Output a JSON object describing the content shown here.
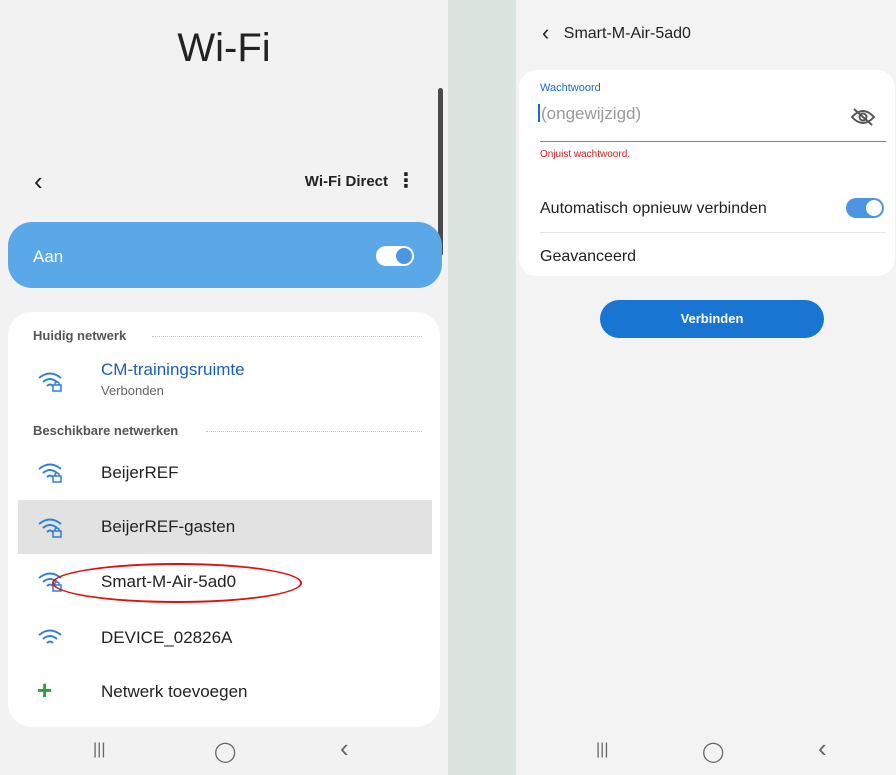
{
  "left_screen": {
    "title": "Wi-Fi",
    "wifi_direct": "Wi-Fi Direct",
    "more_icon": "⋮",
    "toggle_label": "Aan",
    "toggle_on": true,
    "current_section": "Huidig netwerk",
    "current_network": {
      "name": "CM-trainingsruimte",
      "status": "Verbonden"
    },
    "available_section": "Beschikbare netwerken",
    "available_networks": [
      {
        "name": "BeijerREF",
        "secured": true
      },
      {
        "name": "BeijerREF-gasten",
        "secured": true,
        "highlighted": true
      },
      {
        "name": "Smart-M-Air-5ad0",
        "secured": true,
        "circled": true
      },
      {
        "name": "DEVICE_02826A",
        "secured": false
      }
    ],
    "add_network": "Netwerk toevoegen",
    "nav": {
      "recent": "|||",
      "home": "◯",
      "back": "‹"
    }
  },
  "right_screen": {
    "header_title": "Smart-M-Air-5ad0",
    "password_label": "Wachtwoord",
    "password_placeholder": "(ongewijzigd)",
    "password_error": "Onjuist wachtwoord.",
    "auto_reconnect_label": "Automatisch opnieuw verbinden",
    "auto_reconnect_on": true,
    "advanced_label": "Geavanceerd",
    "connect_button": "Verbinden",
    "nav": {
      "recent": "|||",
      "home": "◯",
      "back": "‹"
    }
  },
  "colors": {
    "accent": "#1876d2",
    "toggle_card": "#5ba8e8",
    "error": "#d21e1e",
    "circle_annotation": "#dd1111",
    "add_icon": "#27a33d"
  },
  "icons": {
    "back": "back-arrow-icon",
    "wifi_secured": "wifi-lock-icon",
    "wifi_open": "wifi-icon",
    "eye_hidden": "eye-off-icon",
    "add": "plus-icon"
  }
}
